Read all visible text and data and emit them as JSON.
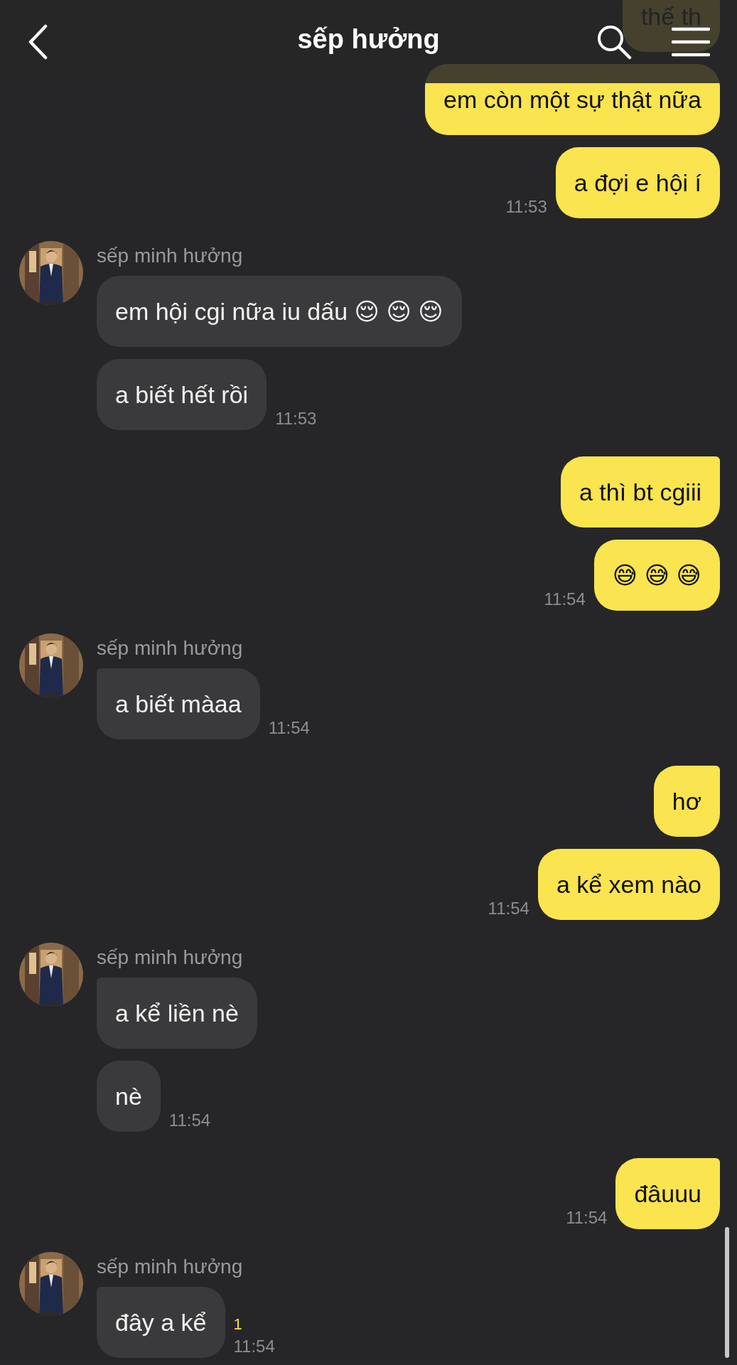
{
  "header": {
    "title": "sếp hưởng"
  },
  "groups": [
    {
      "kind": "sent",
      "bubbles": [
        {
          "text": "thế th"
        },
        {
          "text": "em còn một sự thật nữa",
          "tail": false
        },
        {
          "text": "a đợi e hội í",
          "tail": false
        }
      ],
      "time": "11:53"
    },
    {
      "kind": "received",
      "sender": "sếp minh hưởng",
      "bubbles": [
        {
          "text": "em hội cgi nữa iu dấu 😌 😌 😌",
          "tail": false
        },
        {
          "text": "a biết hết rồi",
          "tail": false
        }
      ],
      "time": "11:53"
    },
    {
      "kind": "sent",
      "bubbles": [
        {
          "text": "a thì bt cgiii",
          "tail": true
        },
        {
          "text": "😅 😅 😅",
          "tail": false
        }
      ],
      "time": "11:54"
    },
    {
      "kind": "received",
      "sender": "sếp minh hưởng",
      "bubbles": [
        {
          "text": "a biết màaa",
          "tail": true
        }
      ],
      "time": "11:54"
    },
    {
      "kind": "sent",
      "bubbles": [
        {
          "text": "hơ",
          "tail": true
        },
        {
          "text": "a kể xem nào",
          "tail": false
        }
      ],
      "time": "11:54"
    },
    {
      "kind": "received",
      "sender": "sếp minh hưởng",
      "bubbles": [
        {
          "text": "a kể liền nè",
          "tail": true
        },
        {
          "text": "nè",
          "tail": false
        }
      ],
      "time": "11:54"
    },
    {
      "kind": "sent",
      "bubbles": [
        {
          "text": "đâuuu",
          "tail": true
        }
      ],
      "time": "11:54"
    },
    {
      "kind": "received",
      "sender": "sếp minh hưởng",
      "bubbles": [
        {
          "text": "đây a kể",
          "tail": true
        }
      ],
      "time": "11:54",
      "unread": "1"
    }
  ]
}
